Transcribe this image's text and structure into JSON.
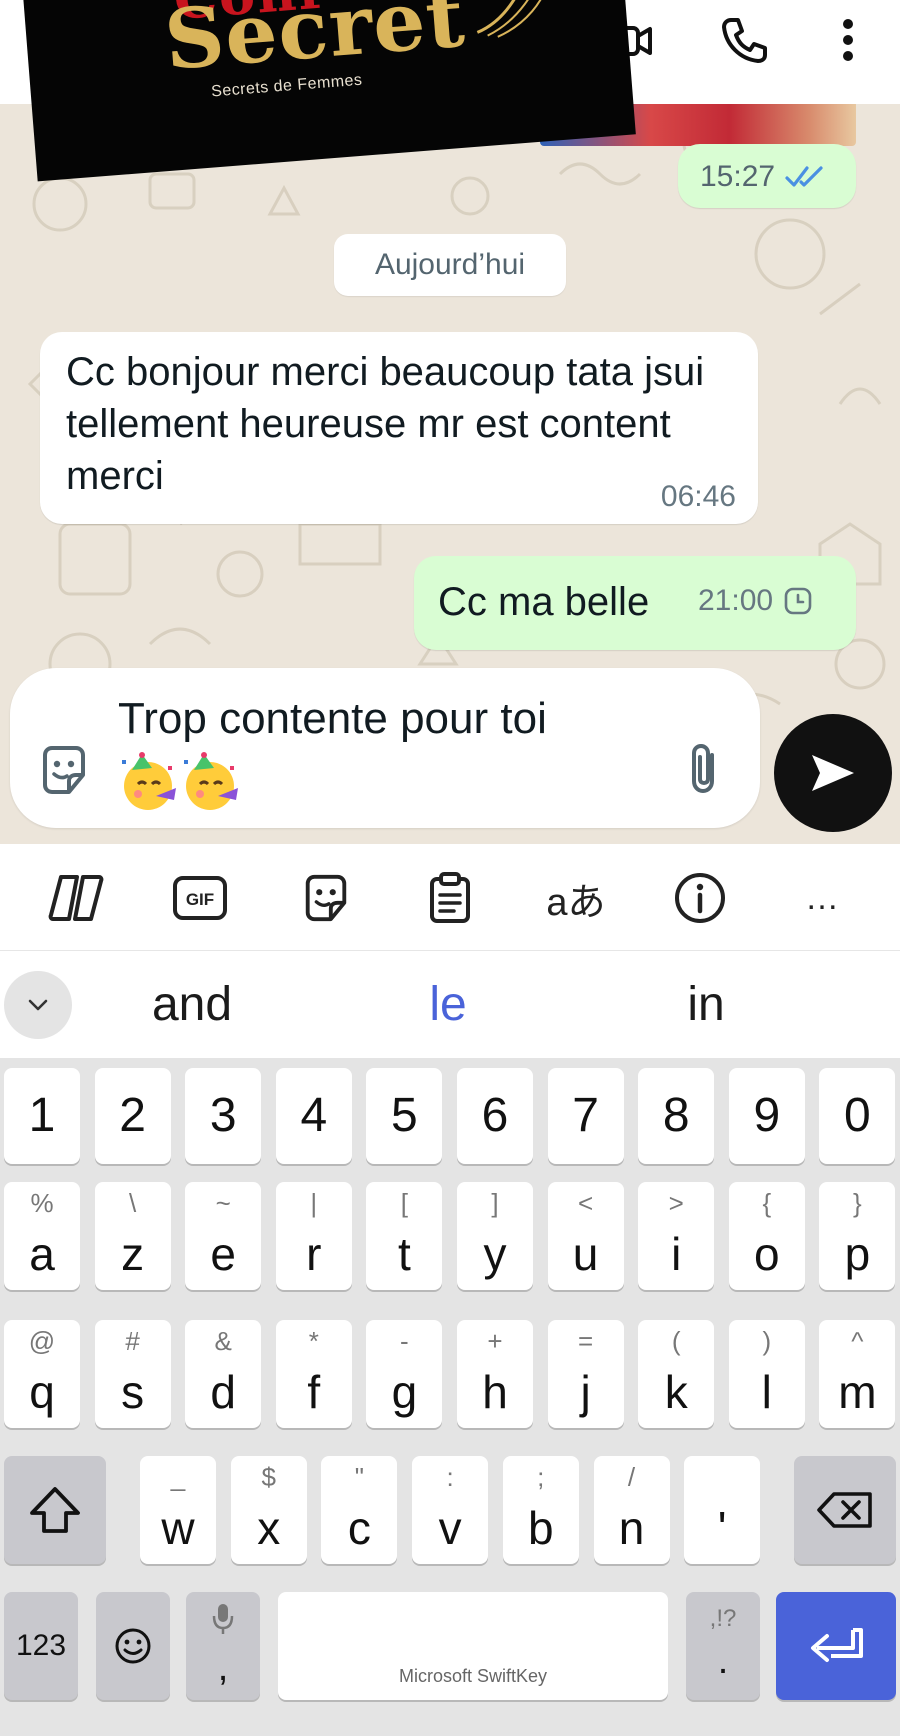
{
  "header": {
    "logo_line1": "Conf",
    "logo_line2": "Secret",
    "logo_tagline": "Secrets de Femmes"
  },
  "chat": {
    "prev_message_time": "15:27",
    "date_divider": "Aujourd’hui",
    "messages": [
      {
        "direction": "incoming",
        "text": "Cc bonjour merci beaucoup tata jsui tellement heureuse mr est content merci",
        "time": "06:46"
      },
      {
        "direction": "outgoing",
        "text": "Cc ma belle",
        "time": "21:00",
        "status": "pending-clock-icon"
      }
    ]
  },
  "composer": {
    "text": "Trop contente pour toi",
    "emojis": [
      "partying-face-emoji",
      "partying-face-emoji"
    ]
  },
  "keyboard": {
    "toolbar_icons": [
      "copilot-icon",
      "gif-icon",
      "sticker-icon",
      "clipboard-icon",
      "translate-icon",
      "info-icon",
      "more-icon"
    ],
    "gif_label": "GIF",
    "translate_label": "aあ",
    "more_label": "…",
    "suggestions": [
      "and",
      "le",
      "in"
    ],
    "suggestion_highlight_color": "#4a63d9",
    "number_row": [
      "1",
      "2",
      "3",
      "4",
      "5",
      "6",
      "7",
      "8",
      "9",
      "0"
    ],
    "row1": [
      {
        "main": "a",
        "sec": "%"
      },
      {
        "main": "z",
        "sec": "\\"
      },
      {
        "main": "e",
        "sec": "~"
      },
      {
        "main": "r",
        "sec": "|"
      },
      {
        "main": "t",
        "sec": "["
      },
      {
        "main": "y",
        "sec": "]"
      },
      {
        "main": "u",
        "sec": "<"
      },
      {
        "main": "i",
        "sec": ">"
      },
      {
        "main": "o",
        "sec": "{"
      },
      {
        "main": "p",
        "sec": "}"
      }
    ],
    "row2": [
      {
        "main": "q",
        "sec": "@"
      },
      {
        "main": "s",
        "sec": "#"
      },
      {
        "main": "d",
        "sec": "&"
      },
      {
        "main": "f",
        "sec": "*"
      },
      {
        "main": "g",
        "sec": "-"
      },
      {
        "main": "h",
        "sec": "+"
      },
      {
        "main": "j",
        "sec": "="
      },
      {
        "main": "k",
        "sec": "("
      },
      {
        "main": "l",
        "sec": ")"
      },
      {
        "main": "m",
        "sec": "^"
      }
    ],
    "row3": [
      {
        "main": "w",
        "sec": "_"
      },
      {
        "main": "x",
        "sec": "$"
      },
      {
        "main": "c",
        "sec": "\""
      },
      {
        "main": "v",
        "sec": ":"
      },
      {
        "main": "b",
        "sec": ";"
      },
      {
        "main": "n",
        "sec": "/"
      },
      {
        "main": "'",
        "sec": ""
      }
    ],
    "key_123": "123",
    "key_comma": ",",
    "key_period": ".",
    "key_period_sec": ",!?",
    "space_label": "Microsoft SwiftKey",
    "enter_color": "#4a63d9"
  }
}
